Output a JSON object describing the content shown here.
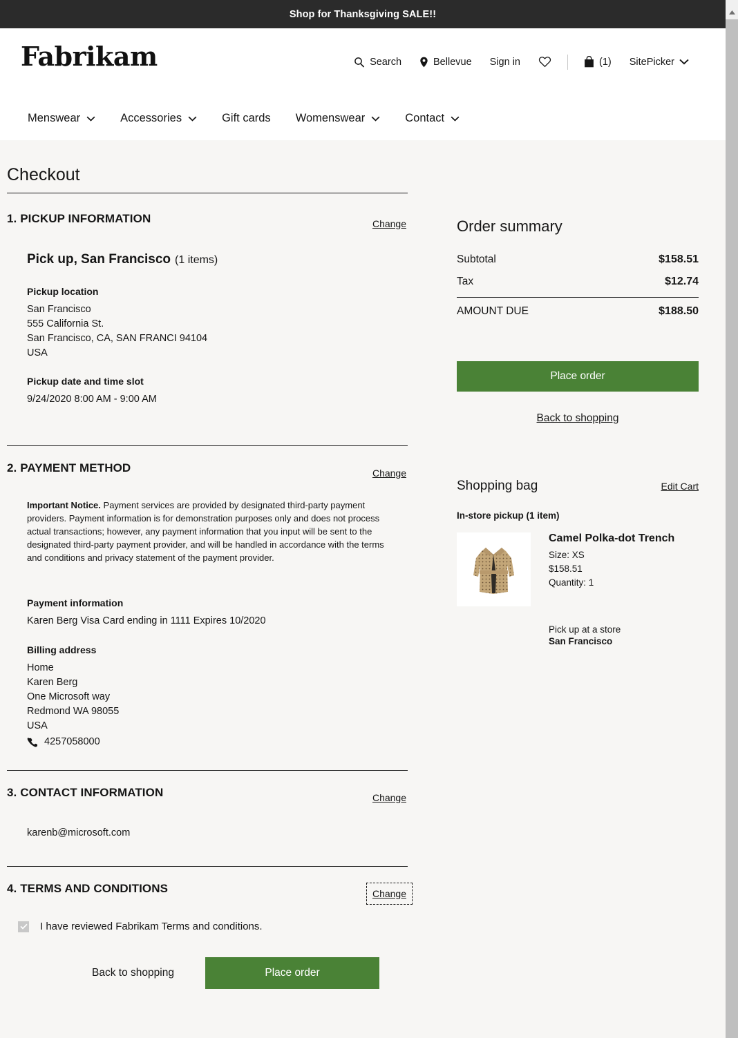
{
  "promo": {
    "text": "Shop for Thanksgiving SALE!!"
  },
  "header": {
    "logo": "Fabrikam",
    "utility": [
      {
        "icon": "search-icon",
        "label": "Search"
      },
      {
        "icon": "location-pin-icon",
        "label": "Bellevue"
      },
      {
        "icon": "",
        "label": "Sign in"
      },
      {
        "icon": "heart-icon",
        "label": ""
      },
      {
        "icon": "shopping-bag-icon",
        "label": "(1)"
      },
      {
        "icon": "chevron-down-icon",
        "label": "SitePicker"
      }
    ],
    "cart_count": "(1)",
    "site_picker": "SitePicker",
    "nav": [
      {
        "label": "Menswear",
        "has_chevron": true
      },
      {
        "label": "Accessories",
        "has_chevron": true
      },
      {
        "label": "Gift cards",
        "has_chevron": false
      },
      {
        "label": "Womenswear",
        "has_chevron": true
      },
      {
        "label": "Contact",
        "has_chevron": true
      }
    ]
  },
  "page": {
    "title": "Checkout"
  },
  "sections": {
    "pickup": {
      "number_title": "1. PICKUP INFORMATION",
      "change": "Change",
      "heading": "Pick up, San Francisco",
      "item_count": "(1 items)",
      "location_label": "Pickup location",
      "address": [
        "San Francisco",
        "555 California St.",
        "San Francisco, CA, SAN FRANCI 94104",
        "USA"
      ],
      "slot_label": "Pickup date and time slot",
      "slot_value": "9/24/2020 8:00 AM - 9:00 AM"
    },
    "payment": {
      "number_title": "2. PAYMENT METHOD",
      "change": "Change",
      "notice_label": "Important Notice.",
      "notice_text": "Payment services are provided by designated third-party payment providers.  Payment information is for demonstration purposes only and does not process actual transactions; however, any payment information that you input will be sent to the designated third-party payment provider, and will be handled in accordance with the terms and conditions and privacy statement of the payment provider.",
      "info_label": "Payment information",
      "card_line": "Karen Berg   Visa   Card ending in 1111   Expires 10/2020",
      "billing_label": "Billing address",
      "billing_address": [
        "Home",
        "Karen Berg",
        "One Microsoft way",
        "Redmond WA  98055",
        "USA"
      ],
      "phone": "4257058000"
    },
    "contact": {
      "number_title": "3. CONTACT INFORMATION",
      "change": "Change",
      "email": "karenb@microsoft.com"
    },
    "terms": {
      "number_title": "4. TERMS AND CONDITIONS",
      "change": "Change",
      "checkbox_label": "I have reviewed Fabrikam Terms and conditions.",
      "checked": true
    }
  },
  "bottom_actions": {
    "back_label": "Back to shopping",
    "place_order_label": "Place order"
  },
  "order_summary": {
    "title": "Order summary",
    "rows": [
      {
        "label": "Subtotal",
        "value": "$158.51"
      },
      {
        "label": "Tax",
        "value": "$12.74"
      }
    ],
    "total_label": "AMOUNT DUE",
    "total_value": "$188.50",
    "place_order_label": "Place order",
    "back_label": "Back to shopping"
  },
  "shopping_bag": {
    "title": "Shopping bag",
    "edit_cart": "Edit Cart",
    "group_label": "In-store pickup (1 item)",
    "item": {
      "name": "Camel Polka-dot Trench",
      "size": "Size: XS",
      "price": "$158.51",
      "quantity": "Quantity: 1",
      "pickup_label": "Pick up at a store",
      "pickup_store": "San Francisco"
    }
  },
  "colors": {
    "accent_green": "#4a8236",
    "banner_dark": "#2b2b2b",
    "page_bg": "#f7f6f4"
  }
}
